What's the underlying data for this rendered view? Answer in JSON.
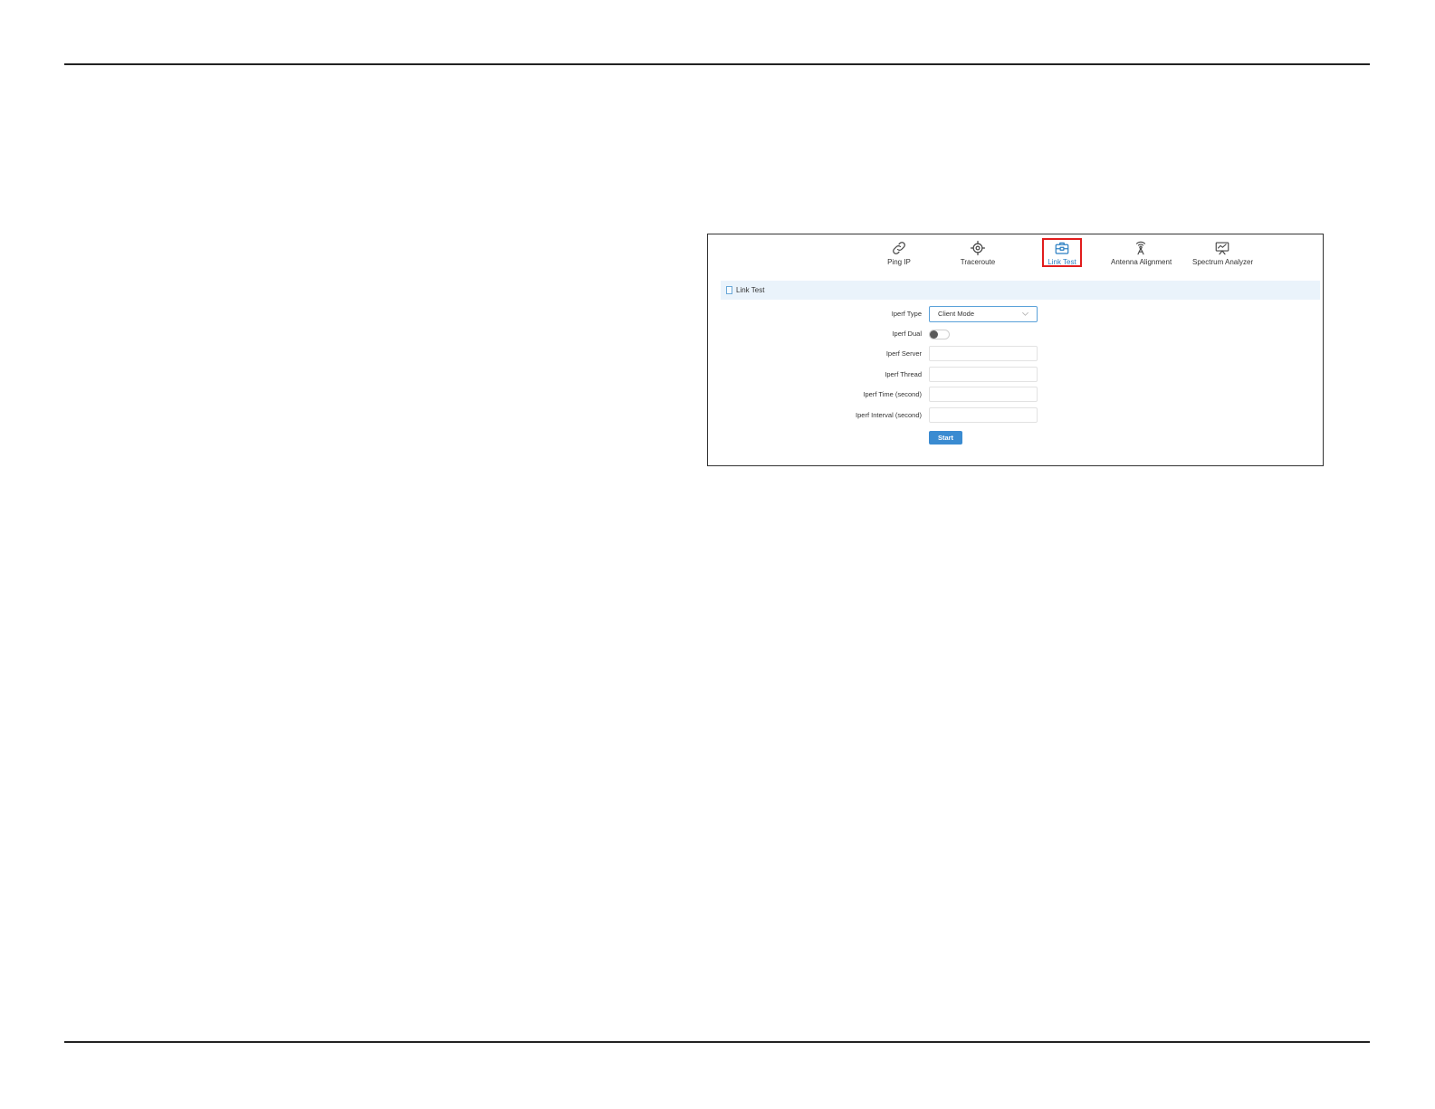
{
  "tools": [
    {
      "label": "Ping IP",
      "icon": "link-icon",
      "active": false
    },
    {
      "label": "Traceroute",
      "icon": "crosshair-icon",
      "active": false
    },
    {
      "label": "Link Test",
      "icon": "toolbox-icon",
      "active": true
    },
    {
      "label": "Antenna Alignment",
      "icon": "antenna-icon",
      "active": false
    },
    {
      "label": "Spectrum Analyzer",
      "icon": "monitor-chart-icon",
      "active": false
    }
  ],
  "section": {
    "title": "Link Test"
  },
  "form": {
    "iperf_type": {
      "label": "Iperf Type",
      "value": "Client Mode"
    },
    "iperf_dual": {
      "label": "Iperf Dual",
      "enabled": false
    },
    "iperf_server": {
      "label": "Iperf Server",
      "value": ""
    },
    "iperf_thread": {
      "label": "Iperf Thread",
      "value": ""
    },
    "iperf_time": {
      "label": "Iperf Time (second)",
      "value": ""
    },
    "iperf_interval": {
      "label": "Iperf Interval (second)",
      "value": ""
    },
    "start_label": "Start"
  },
  "colors": {
    "accent": "#3a8bd1",
    "active_tab_text": "#2a7ec2",
    "highlight_frame": "#e11d1d",
    "section_bg": "#eaf3fb"
  }
}
